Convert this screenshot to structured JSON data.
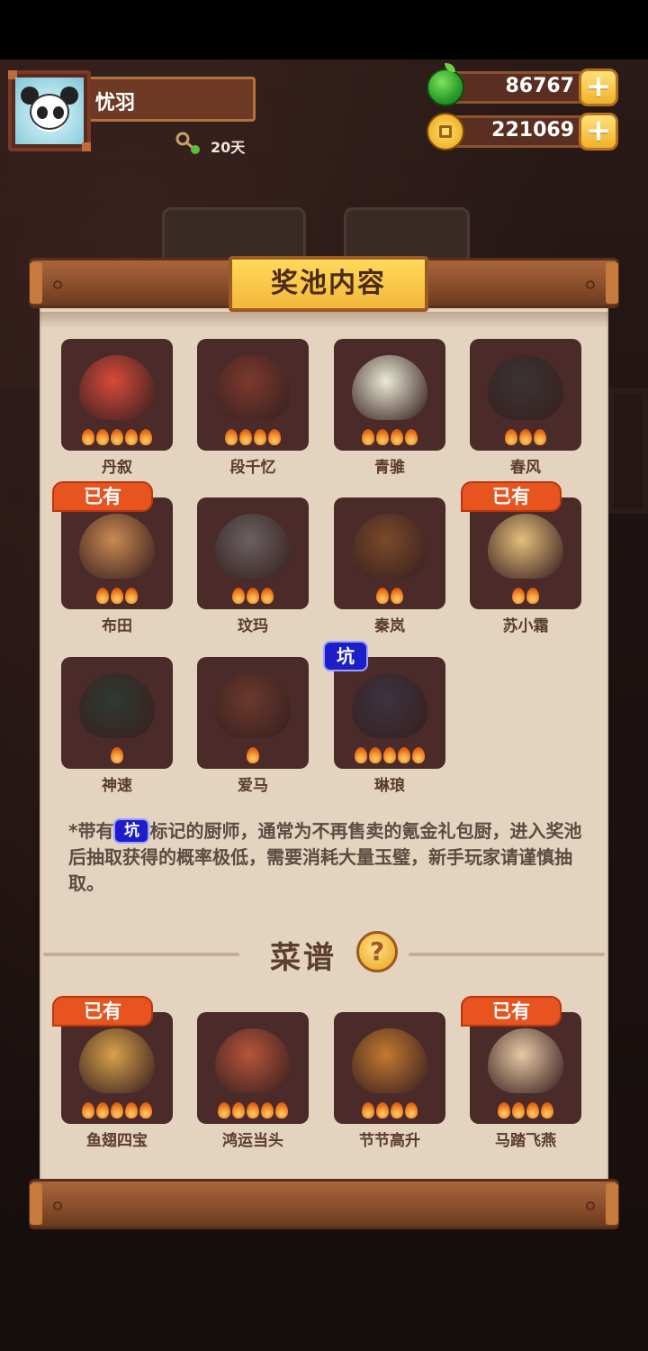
{
  "header": {
    "username": "忧羽",
    "days": "20天",
    "resources": [
      {
        "name": "apple",
        "value": "86767",
        "icon": "green-apple-icon"
      },
      {
        "name": "coin",
        "value": "221069",
        "icon": "gold-coin-icon"
      }
    ],
    "plus_label": "+"
  },
  "panel": {
    "title": "奖池内容",
    "chefs": [
      {
        "name": "丹叙",
        "owned": false,
        "pit": false,
        "stars": 5,
        "color": "#d84b3a"
      },
      {
        "name": "段千忆",
        "owned": false,
        "pit": false,
        "stars": 4,
        "color": "#7c3a2e"
      },
      {
        "name": "青骓",
        "owned": false,
        "pit": false,
        "stars": 4,
        "color": "#e9ecd4"
      },
      {
        "name": "春风",
        "owned": false,
        "pit": false,
        "stars": 3,
        "color": "#3a3434"
      },
      {
        "name": "布田",
        "owned": true,
        "pit": false,
        "stars": 3,
        "color": "#c98a52"
      },
      {
        "name": "玟玛",
        "owned": false,
        "pit": false,
        "stars": 3,
        "color": "#6a6262"
      },
      {
        "name": "秦岚",
        "owned": false,
        "pit": false,
        "stars": 2,
        "color": "#7a4a2a"
      },
      {
        "name": "苏小霜",
        "owned": true,
        "pit": false,
        "stars": 2,
        "color": "#e4bf7a"
      },
      {
        "name": "神速",
        "owned": false,
        "pit": false,
        "stars": 1,
        "color": "#2f3a32"
      },
      {
        "name": "爱马",
        "owned": false,
        "pit": false,
        "stars": 1,
        "color": "#6a3a2c"
      },
      {
        "name": "琳琅",
        "owned": false,
        "pit": true,
        "stars": 5,
        "color": "#3a3440"
      }
    ],
    "owned_label": "已有",
    "pit_label": "坑",
    "note_prefix": "*带有",
    "note_suffix": "标记的厨师，通常为不再售卖的氪金礼包厨，进入奖池后抽取获得的概率极低，需要消耗大量玉璧，新手玩家请谨慎抽取。",
    "recipes_title": "菜谱",
    "help_label": "?",
    "recipes": [
      {
        "name": "鱼翅四宝",
        "owned": true,
        "stars": 5,
        "color": "#d8a24a"
      },
      {
        "name": "鸿运当头",
        "owned": false,
        "stars": 5,
        "color": "#b8553a"
      },
      {
        "name": "节节高升",
        "owned": false,
        "stars": 4,
        "color": "#c47a30"
      },
      {
        "name": "马踏飞燕",
        "owned": true,
        "stars": 4,
        "color": "#e7c9a4"
      }
    ]
  }
}
